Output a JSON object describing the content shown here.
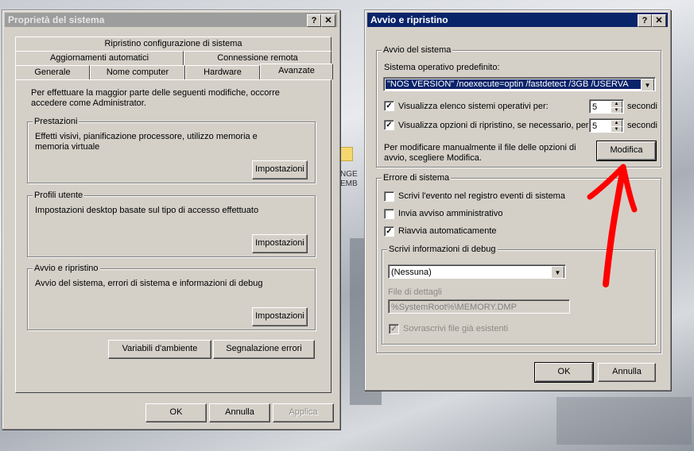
{
  "left_window": {
    "title": "Proprietà del sistema",
    "help_btn": "?",
    "close_btn": "✕",
    "tabs_row1": [
      "Ripristino configurazione di sistema"
    ],
    "tabs_row2": [
      "Aggiornamenti automatici",
      "Connessione remota"
    ],
    "tabs_row3": [
      "Generale",
      "Nome computer",
      "Hardware",
      "Avanzate"
    ],
    "intro": "Per effettuare la maggior parte delle seguenti modifiche, occorre accedere come Administrator.",
    "perf": {
      "label": "Prestazioni",
      "desc": "Effetti visivi, pianificazione processore, utilizzo memoria e memoria virtuale",
      "btn": "Impostazioni"
    },
    "profiles": {
      "label": "Profili utente",
      "desc": "Impostazioni desktop basate sul tipo di accesso effettuato",
      "btn": "Impostazioni"
    },
    "startup": {
      "label": "Avvio e ripristino",
      "desc": "Avvio del sistema, errori di sistema e informazioni di debug",
      "btn": "Impostazioni"
    },
    "env_btn": "Variabili d'ambiente",
    "err_btn": "Segnalazione errori",
    "ok": "OK",
    "cancel": "Annulla",
    "apply": "Applica"
  },
  "right_window": {
    "title": "Avvio e ripristino",
    "help_btn": "?",
    "close_btn": "✕",
    "system_startup": {
      "label": "Avvio del sistema",
      "default_os_label": "Sistema operativo predefinito:",
      "default_os_value": "\"NOS VERSION\" /noexecute=optin /fastdetect /3GB /USERVA",
      "show_list_label": "Visualizza elenco sistemi operativi per:",
      "show_list_value": "5",
      "show_recovery_label": "Visualizza opzioni di ripristino, se necessario, per:",
      "show_recovery_value": "5",
      "seconds": "secondi",
      "edit_text": "Per modificare manualmente il file delle opzioni di avvio, scegliere Modifica.",
      "edit_btn": "Modifica"
    },
    "system_failure": {
      "label": "Errore di sistema",
      "write_event": "Scrivi l'evento nel registro eventi di sistema",
      "send_alert": "Invia avviso amministrativo",
      "auto_restart": "Riavvia automaticamente",
      "debug": {
        "label": "Scrivi informazioni di debug",
        "select_value": "(Nessuna)",
        "dump_file_label": "File di dettagli",
        "dump_file_value": "%SystemRoot%\\MEMORY.DMP",
        "overwrite": "Sovrascrivi file già esistenti"
      }
    },
    "ok": "OK",
    "cancel": "Annulla"
  },
  "desktop": {
    "icon_text_1": "NGE",
    "icon_text_2": "EMB"
  },
  "colors": {
    "titlebar_active": "#0a246a",
    "titlebar_inactive": "#9d9d9d",
    "face": "#d4d0c8",
    "arrow": "#ff0000"
  }
}
